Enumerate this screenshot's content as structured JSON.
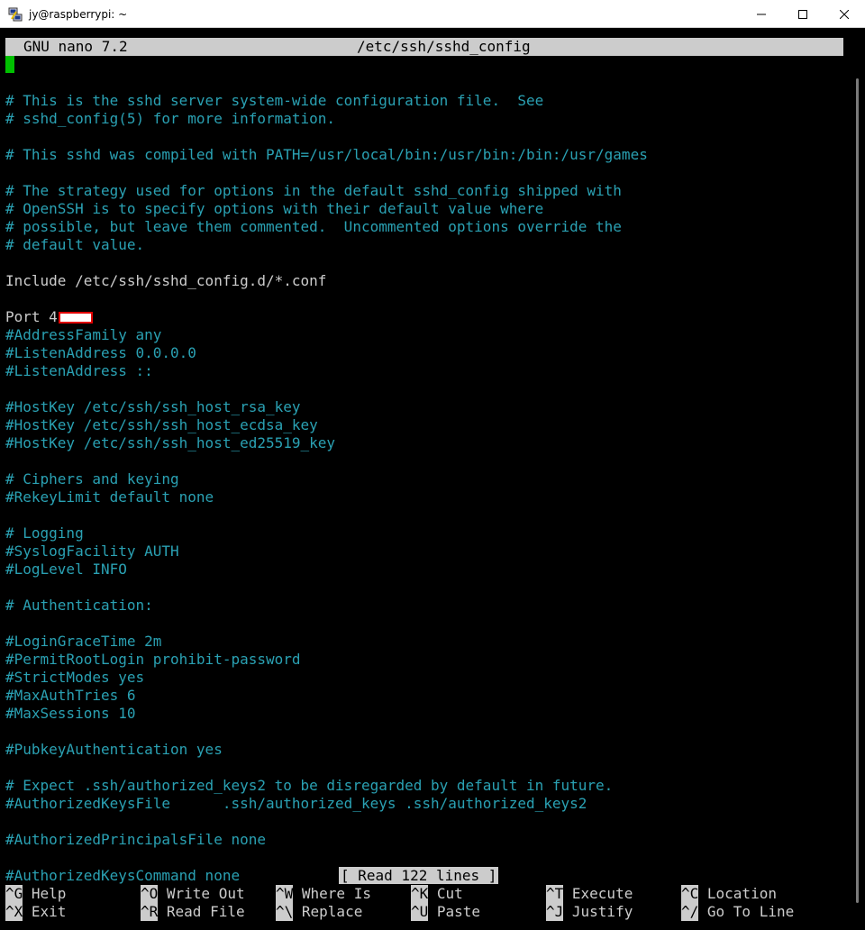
{
  "window": {
    "title": "jy@raspberrypi: ~"
  },
  "nano": {
    "version": "GNU nano 7.2",
    "filename": "/etc/ssh/sshd_config",
    "status": "[ Read 122 lines ]"
  },
  "lines": [
    {
      "text": "",
      "type": "plain"
    },
    {
      "text": "# This is the sshd server system-wide configuration file.  See",
      "type": "comment"
    },
    {
      "text": "# sshd_config(5) for more information.",
      "type": "comment"
    },
    {
      "text": "",
      "type": "plain"
    },
    {
      "text": "# This sshd was compiled with PATH=/usr/local/bin:/usr/bin:/bin:/usr/games",
      "type": "comment"
    },
    {
      "text": "",
      "type": "plain"
    },
    {
      "text": "# The strategy used for options in the default sshd_config shipped with",
      "type": "comment"
    },
    {
      "text": "# OpenSSH is to specify options with their default value where",
      "type": "comment"
    },
    {
      "text": "# possible, but leave them commented.  Uncommented options override the",
      "type": "comment"
    },
    {
      "text": "# default value.",
      "type": "comment"
    },
    {
      "text": "",
      "type": "plain"
    },
    {
      "text": "Include /etc/ssh/sshd_config.d/*.conf",
      "type": "plain"
    },
    {
      "text": "",
      "type": "plain"
    },
    {
      "text": "Port 4",
      "type": "plain",
      "redacted": true
    },
    {
      "text": "#AddressFamily any",
      "type": "comment"
    },
    {
      "text": "#ListenAddress 0.0.0.0",
      "type": "comment"
    },
    {
      "text": "#ListenAddress ::",
      "type": "comment"
    },
    {
      "text": "",
      "type": "plain"
    },
    {
      "text": "#HostKey /etc/ssh/ssh_host_rsa_key",
      "type": "comment"
    },
    {
      "text": "#HostKey /etc/ssh/ssh_host_ecdsa_key",
      "type": "comment"
    },
    {
      "text": "#HostKey /etc/ssh/ssh_host_ed25519_key",
      "type": "comment"
    },
    {
      "text": "",
      "type": "plain"
    },
    {
      "text": "# Ciphers and keying",
      "type": "comment"
    },
    {
      "text": "#RekeyLimit default none",
      "type": "comment"
    },
    {
      "text": "",
      "type": "plain"
    },
    {
      "text": "# Logging",
      "type": "comment"
    },
    {
      "text": "#SyslogFacility AUTH",
      "type": "comment"
    },
    {
      "text": "#LogLevel INFO",
      "type": "comment"
    },
    {
      "text": "",
      "type": "plain"
    },
    {
      "text": "# Authentication:",
      "type": "comment"
    },
    {
      "text": "",
      "type": "plain"
    },
    {
      "text": "#LoginGraceTime 2m",
      "type": "comment"
    },
    {
      "text": "#PermitRootLogin prohibit-password",
      "type": "comment"
    },
    {
      "text": "#StrictModes yes",
      "type": "comment"
    },
    {
      "text": "#MaxAuthTries 6",
      "type": "comment"
    },
    {
      "text": "#MaxSessions 10",
      "type": "comment"
    },
    {
      "text": "",
      "type": "plain"
    },
    {
      "text": "#PubkeyAuthentication yes",
      "type": "comment"
    },
    {
      "text": "",
      "type": "plain"
    },
    {
      "text": "# Expect .ssh/authorized_keys2 to be disregarded by default in future.",
      "type": "comment"
    },
    {
      "text": "#AuthorizedKeysFile      .ssh/authorized_keys .ssh/authorized_keys2",
      "type": "comment"
    },
    {
      "text": "",
      "type": "plain"
    },
    {
      "text": "#AuthorizedPrincipalsFile none",
      "type": "comment"
    },
    {
      "text": "",
      "type": "plain"
    },
    {
      "text": "#AuthorizedKeysCommand none",
      "type": "comment"
    }
  ],
  "shortcuts": [
    [
      {
        "key": "^G",
        "label": "Help"
      },
      {
        "key": "^O",
        "label": "Write Out"
      },
      {
        "key": "^W",
        "label": "Where Is"
      },
      {
        "key": "^K",
        "label": "Cut"
      },
      {
        "key": "^T",
        "label": "Execute"
      },
      {
        "key": "^C",
        "label": "Location"
      }
    ],
    [
      {
        "key": "^X",
        "label": "Exit"
      },
      {
        "key": "^R",
        "label": "Read File"
      },
      {
        "key": "^\\",
        "label": "Replace"
      },
      {
        "key": "^U",
        "label": "Paste"
      },
      {
        "key": "^J",
        "label": "Justify"
      },
      {
        "key": "^/",
        "label": "Go To Line"
      }
    ]
  ],
  "colors": {
    "comment": "#2aa1b3",
    "plain": "#cccccc",
    "cursor": "#00c000",
    "bar": "#cccccc",
    "redaction_border": "#e00000"
  },
  "icons": {
    "app": "putty-icon",
    "minimize": "minimize-icon",
    "maximize": "maximize-icon",
    "close": "close-icon"
  }
}
